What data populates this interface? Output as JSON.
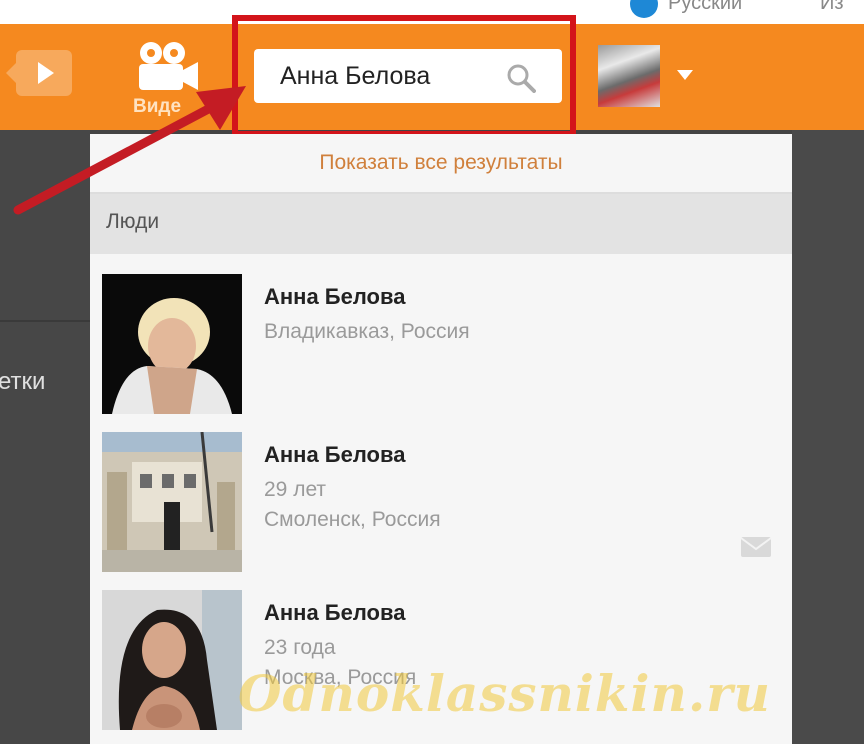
{
  "top": {
    "language_label": "Русский",
    "right_text": "Из"
  },
  "toolbar": {
    "video_label": "Виде",
    "search_value": "Анна Белова",
    "caret": "▼",
    "colors": {
      "toolbar": "#f5891f",
      "highlight": "#d3141a",
      "arrow": "#c41c24"
    }
  },
  "background": {
    "left_text": "етки"
  },
  "dropdown": {
    "show_all": "Показать все результаты",
    "section_label": "Люди",
    "results": [
      {
        "name": "Анна Белова",
        "lines": [
          "Владикавказ, Россия"
        ]
      },
      {
        "name": "Анна Белова",
        "lines": [
          "29 лет",
          "Смоленск, Россия"
        ],
        "icon": "mail-icon"
      },
      {
        "name": "Анна Белова",
        "lines": [
          "23 года",
          "Москва, Россия"
        ]
      }
    ]
  },
  "watermark": "Odnoklassnikin.ru"
}
